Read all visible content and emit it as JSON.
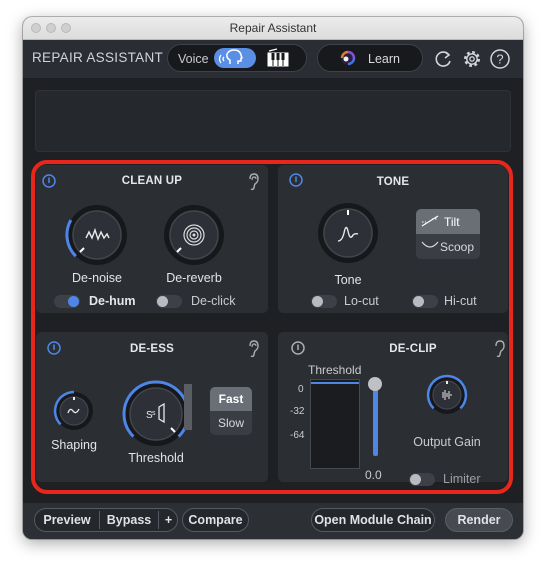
{
  "window": {
    "title": "Repair Assistant"
  },
  "header": {
    "app_title": "REPAIR ASSISTANT",
    "mode_label": "Voice",
    "learn_label": "Learn"
  },
  "clean_up": {
    "title": "CLEAN UP",
    "denoise_label": "De-noise",
    "dereverb_label": "De-reverb",
    "dehum_label": "De-hum",
    "declick_label": "De-click",
    "dehum_on": true,
    "declick_on": false
  },
  "tone": {
    "title": "TONE",
    "tone_label": "Tone",
    "tilt_label": "Tilt",
    "scoop_label": "Scoop",
    "selected": "Tilt",
    "locut_label": "Lo-cut",
    "hicut_label": "Hi-cut"
  },
  "de_ess": {
    "title": "DE-ESS",
    "shaping_label": "Shaping",
    "threshold_label": "Threshold",
    "fast_label": "Fast",
    "slow_label": "Slow",
    "selected": "Fast"
  },
  "de_clip": {
    "title": "DE-CLIP",
    "threshold_label": "Threshold",
    "scale": [
      "0",
      "-32",
      "-64"
    ],
    "threshold_value": "0.0",
    "output_gain_label": "Output Gain",
    "limiter_label": "Limiter",
    "limiter_on": false
  },
  "footer": {
    "preview_label": "Preview",
    "bypass_label": "Bypass",
    "plus_label": "+",
    "compare_label": "Compare",
    "open_chain_label": "Open Module Chain",
    "render_label": "Render"
  },
  "colors": {
    "accent": "#4e86e8",
    "highlight": "#e8261c",
    "panel": "#2b2e33",
    "background": "#1e2024"
  }
}
